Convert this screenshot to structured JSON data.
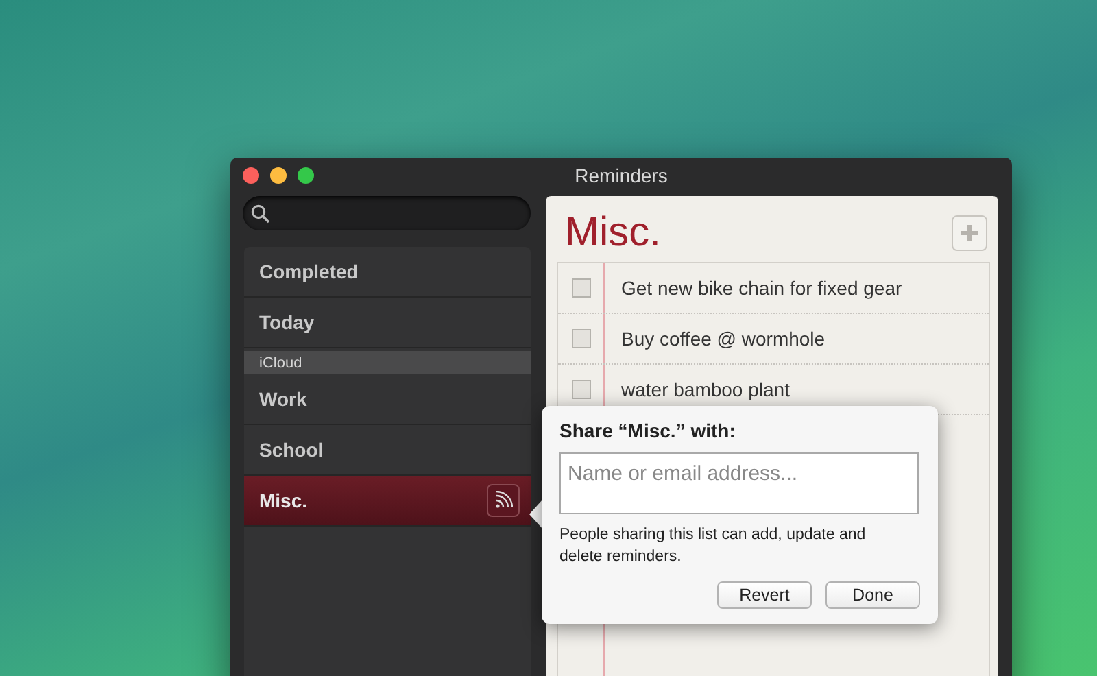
{
  "window": {
    "title": "Reminders"
  },
  "sidebar": {
    "items": [
      {
        "kind": "item",
        "label": "Completed",
        "selected": false,
        "shared": false
      },
      {
        "kind": "item",
        "label": "Today",
        "selected": false,
        "shared": false
      },
      {
        "kind": "header",
        "label": "iCloud"
      },
      {
        "kind": "item",
        "label": "Work",
        "selected": false,
        "shared": false
      },
      {
        "kind": "item",
        "label": "School",
        "selected": false,
        "shared": false
      },
      {
        "kind": "item",
        "label": "Misc.",
        "selected": true,
        "shared": true
      }
    ]
  },
  "list": {
    "title": "Misc.",
    "reminders": [
      {
        "text": "Get new bike chain for fixed gear",
        "checked": false
      },
      {
        "text": "Buy coffee @ wormhole",
        "checked": false
      },
      {
        "text": "water bamboo plant",
        "checked": false
      }
    ]
  },
  "share_popover": {
    "title": "Share “Misc.” with:",
    "placeholder": "Name or email address...",
    "note": "People sharing this list can add, update and delete reminders.",
    "buttons": [
      "Revert",
      "Done"
    ]
  }
}
